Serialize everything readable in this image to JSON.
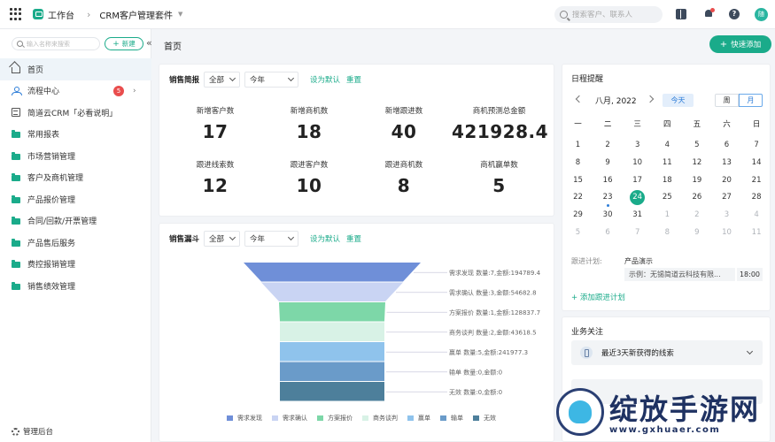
{
  "topbar": {
    "workspace": "工作台",
    "suite": "CRM客户管理套件",
    "search_placeholder": "搜索客户、联系人",
    "avatar_text": "随"
  },
  "sidebar": {
    "search_placeholder": "输入名称来搜索",
    "new_label": "新建",
    "items": [
      {
        "label": "首页"
      },
      {
        "label": "流程中心",
        "badge": "5"
      },
      {
        "label": "简道云CRM「必看说明」"
      },
      {
        "label": "常用报表"
      },
      {
        "label": "市场营销管理"
      },
      {
        "label": "客户及商机管理"
      },
      {
        "label": "产品报价管理"
      },
      {
        "label": "合同/回款/开票管理"
      },
      {
        "label": "产品售后服务"
      },
      {
        "label": "费控报销管理"
      },
      {
        "label": "销售绩效管理"
      }
    ],
    "footer": "管理后台"
  },
  "header": {
    "title": "首页",
    "quick_add": "快速添加"
  },
  "sales_brief": {
    "title": "销售简报",
    "scope": "全部",
    "period": "今年",
    "set_default": "设为默认",
    "reset": "重置",
    "stats": [
      {
        "label": "新增客户数",
        "value": "17"
      },
      {
        "label": "新增商机数",
        "value": "18"
      },
      {
        "label": "新增跟进数",
        "value": "40"
      },
      {
        "label": "商机预测总金额",
        "value": "421928.4"
      },
      {
        "label": "跟进线索数",
        "value": "12"
      },
      {
        "label": "跟进客户数",
        "value": "10"
      },
      {
        "label": "跟进商机数",
        "value": "8"
      },
      {
        "label": "商机赢单数",
        "value": "5"
      }
    ]
  },
  "funnel": {
    "title": "销售漏斗",
    "scope": "全部",
    "period": "今年",
    "set_default": "设为默认",
    "reset": "重置"
  },
  "chart_data": {
    "type": "funnel",
    "series": [
      {
        "stage": "需求发现",
        "count": 7,
        "amount": 194789.4,
        "color": "#6f8fd8",
        "label": "需求发现 数量:7,金额:194789.4"
      },
      {
        "stage": "需求确认",
        "count": 3,
        "amount": 54682.8,
        "color": "#c9d4f3",
        "label": "需求确认 数量:3,金额:54682.8"
      },
      {
        "stage": "方案报价",
        "count": 1,
        "amount": 128837.7,
        "color": "#7dd7a8",
        "label": "方案报价 数量:1,金额:128837.7"
      },
      {
        "stage": "商务谈判",
        "count": 2,
        "amount": 43618.5,
        "color": "#d8f2e6",
        "label": "商务谈判 数量:2,金额:43618.5"
      },
      {
        "stage": "赢单",
        "count": 5,
        "amount": 241977.3,
        "color": "#8fc3ec",
        "label": "赢单 数量:5,金额:241977.3"
      },
      {
        "stage": "输单",
        "count": 0,
        "amount": 0,
        "color": "#6a9bc9",
        "label": "输单 数量:0,金额:0"
      },
      {
        "stage": "无效",
        "count": 0,
        "amount": 0,
        "color": "#4d7f9b",
        "label": "无效 数量:0,金额:0"
      }
    ]
  },
  "calendar": {
    "title": "日程提醒",
    "month": "八月, 2022",
    "today_btn": "今天",
    "week_btn": "周",
    "month_btn": "月",
    "weekdays": [
      "一",
      "二",
      "三",
      "四",
      "五",
      "六",
      "日"
    ],
    "weeks": [
      [
        {
          "d": "1"
        },
        {
          "d": "2"
        },
        {
          "d": "3"
        },
        {
          "d": "4"
        },
        {
          "d": "5"
        },
        {
          "d": "6"
        },
        {
          "d": "7"
        }
      ],
      [
        {
          "d": "8"
        },
        {
          "d": "9"
        },
        {
          "d": "10"
        },
        {
          "d": "11"
        },
        {
          "d": "12"
        },
        {
          "d": "13"
        },
        {
          "d": "14"
        }
      ],
      [
        {
          "d": "15"
        },
        {
          "d": "16"
        },
        {
          "d": "17"
        },
        {
          "d": "18"
        },
        {
          "d": "19"
        },
        {
          "d": "20"
        },
        {
          "d": "21"
        }
      ],
      [
        {
          "d": "22"
        },
        {
          "d": "23",
          "dot": true
        },
        {
          "d": "24",
          "today": true
        },
        {
          "d": "25"
        },
        {
          "d": "26"
        },
        {
          "d": "27"
        },
        {
          "d": "28"
        }
      ],
      [
        {
          "d": "29"
        },
        {
          "d": "30"
        },
        {
          "d": "31"
        },
        {
          "d": "1",
          "other": true
        },
        {
          "d": "2",
          "other": true
        },
        {
          "d": "3",
          "other": true
        },
        {
          "d": "4",
          "other": true
        }
      ],
      [
        {
          "d": "5",
          "other": true
        },
        {
          "d": "6",
          "other": true
        },
        {
          "d": "7",
          "other": true
        },
        {
          "d": "8",
          "other": true
        },
        {
          "d": "9",
          "other": true
        },
        {
          "d": "10",
          "other": true
        },
        {
          "d": "11",
          "other": true
        }
      ]
    ],
    "schedule_label": "跟进计划:",
    "schedule_title": "产品演示",
    "schedule_detail": "示例：无锡简道云科技有限...",
    "schedule_time": "18:00",
    "add_plan": "添加跟进计划"
  },
  "focus": {
    "title": "业务关注",
    "item1": "最近3天新获得的线索"
  },
  "watermark": {
    "text": "绽放手游网",
    "url": "www.gxhuaer.com"
  }
}
